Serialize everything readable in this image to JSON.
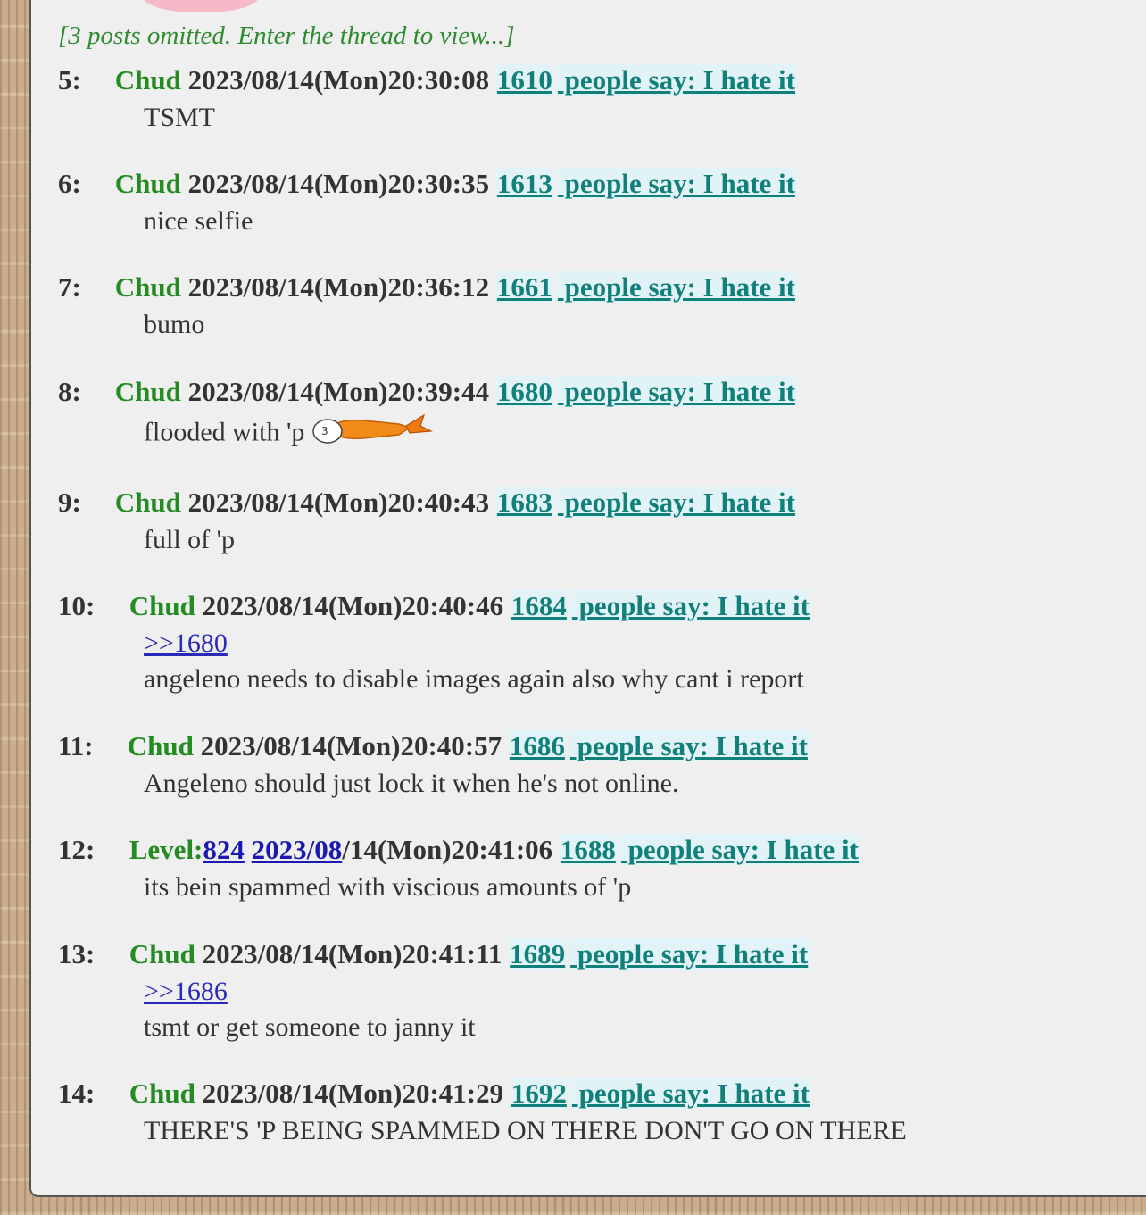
{
  "thread": {
    "omitted_text": "[3 posts omitted. Enter the thread to view...]"
  },
  "posts": [
    {
      "num": "5",
      "sep": ":",
      "name": "Chud",
      "date": "2023/08/14(Mon)20:30:08",
      "id": "1610",
      "hate": " people say: I hate it",
      "reply": "",
      "text": "TSMT"
    },
    {
      "num": "6",
      "sep": ":",
      "name": "Chud",
      "date": "2023/08/14(Mon)20:30:35",
      "id": "1613",
      "hate": " people say: I hate it",
      "reply": "",
      "text": "nice selfie"
    },
    {
      "num": "7",
      "sep": ":",
      "name": "Chud",
      "date": "2023/08/14(Mon)20:36:12",
      "id": "1661",
      "hate": " people say: I hate it",
      "reply": "",
      "text": "bumo"
    },
    {
      "num": "8",
      "sep": ":",
      "name": "Chud",
      "date": "2023/08/14(Mon)20:39:44",
      "id": "1680",
      "hate": " people say: I hate it",
      "reply": "",
      "text": "flooded with 'p",
      "emoji": "shrimp-tempura-icon"
    },
    {
      "num": "9",
      "sep": ":",
      "name": "Chud",
      "date": "2023/08/14(Mon)20:40:43",
      "id": "1683",
      "hate": " people say: I hate it",
      "reply": "",
      "text": "full of 'p"
    },
    {
      "num": "10",
      "sep": ":",
      "name": "Chud",
      "date": "2023/08/14(Mon)20:40:46",
      "id": "1684",
      "hate": " people say: I hate it",
      "reply": ">>1680",
      "text": "angeleno needs to disable images again also why cant i report"
    },
    {
      "num": "11",
      "sep": ":",
      "name": "Chud",
      "date": "2023/08/14(Mon)20:40:57",
      "id": "1686",
      "hate": " people say: I hate it",
      "reply": "",
      "text": "Angeleno should just lock it when he's not online."
    },
    {
      "num": "12",
      "sep": ":",
      "name_prefix": "Level:",
      "level": "824",
      "date_link": "2023/08",
      "date_rest": "/14(Mon)20:41:06",
      "id": "1688",
      "hate": " people say: I hate it",
      "reply": "",
      "text": "its bein spammed with viscious amounts of 'p"
    },
    {
      "num": "13",
      "sep": ":",
      "name": "Chud",
      "date": "2023/08/14(Mon)20:41:11",
      "id": "1689",
      "hate": " people say: I hate it",
      "reply": ">>1686",
      "text": "tsmt or get someone to janny it"
    },
    {
      "num": "14",
      "sep": ":",
      "name": "Chud",
      "date": "2023/08/14(Mon)20:41:29",
      "id": "1692",
      "hate": " people say: I hate it",
      "reply": "",
      "text": "THERE'S 'P BEING SPAMMED ON THERE DON'T GO ON THERE"
    }
  ],
  "colors": {
    "name": "#228b22",
    "link_teal": "#11807a",
    "reply_link": "#2a2ab8",
    "omitted": "#2e8b2e",
    "panel_bg": "#efefef"
  }
}
